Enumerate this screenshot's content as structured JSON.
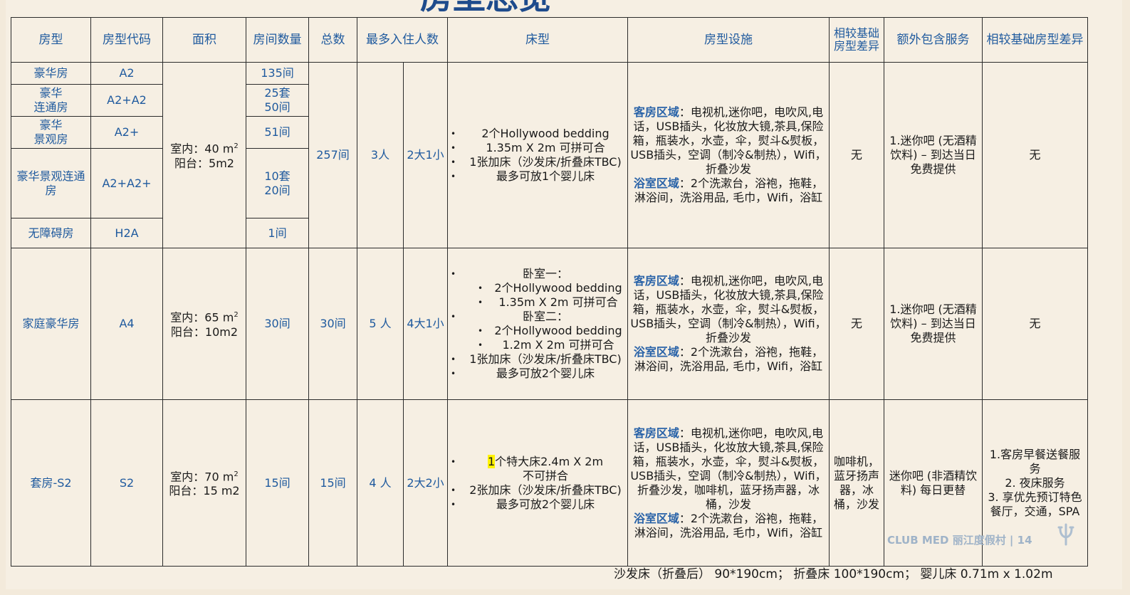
{
  "title_fragment": "房型总览",
  "headers": [
    "房型",
    "房型代码",
    "面积",
    "房间数量",
    "总数",
    "最多入住人数",
    "床型",
    "房型设施",
    "相较基础房型差异",
    "额外包含服务",
    "相较基础房型差异"
  ],
  "group1": {
    "rooms": [
      {
        "type": "豪华房",
        "code": "A2",
        "count": "135间"
      },
      {
        "type": "豪华\n连通房",
        "code": "A2+A2",
        "count": "25套\n50间"
      },
      {
        "type": "豪华\n景观房",
        "code": "A2+",
        "count": "51间"
      },
      {
        "type": "豪华景观连通房",
        "code": "A2+A2+",
        "count": "10套\n20间"
      },
      {
        "type": "无障碍房",
        "code": "H2A",
        "count": "1间"
      }
    ],
    "area_line1": "室内：40 m",
    "area_sup": "2",
    "area_line2": "阳台：5m2",
    "total": "257间",
    "max_people": "3人",
    "composition": "2大1小",
    "beds": [
      "2个Hollywood bedding",
      "1.35m X 2m 可拼可合",
      "1张加床（沙发床/折叠床TBC)",
      "最多可放1个婴儿床"
    ],
    "fac_room_label": "客房区域",
    "fac_room": "：电视机,迷你吧，电吹风,电话，USB插头，化妆放大镜,茶具,保险箱，瓶装水，水壶，伞，熨斗&熨板，USB插头，空调（制冷&制热），Wifi，折叠沙发",
    "fac_bath_label": "浴室区域",
    "fac_bath": "：2个洗漱台，浴袍，拖鞋，淋浴间，洗浴用品, 毛巾，Wifi，浴缸",
    "diff": "无",
    "service": "1.迷你吧 (无酒精饮料) – 到达当日免费提供",
    "diff2": "无"
  },
  "group2": {
    "type": "家庭豪华房",
    "code": "A4",
    "area_line1": "室内：65 m",
    "area_sup": "2",
    "area_line2": "阳台：10m2",
    "count": "30间",
    "total": "30间",
    "max_people": "5 人",
    "composition": "4大1小",
    "bedroom1": "卧室一：",
    "bedroom1_items": [
      "2个Hollywood bedding",
      "1.35m X 2m 可拼可合"
    ],
    "bedroom2": "卧室二：",
    "bedroom2_items": [
      "2个Hollywood bedding",
      "1.2m X 2m   可拼可合"
    ],
    "beds_extra": [
      "1张加床（沙发床/折叠床TBC)",
      "最多可放2个婴儿床"
    ],
    "fac_room_label": "客房区域",
    "fac_room": "：电视机,迷你吧，电吹风,电话，USB插头，化妆放大镜,茶具,保险箱，瓶装水，水壶，伞，熨斗&熨板，USB插头，空调（制冷&制热），Wifi，折叠沙发",
    "fac_bath_label": "浴室区域",
    "fac_bath": "：2个洗漱台，浴袍，拖鞋，淋浴间，洗浴用品, 毛巾，Wifi，浴缸",
    "diff": "无",
    "service": "1.迷你吧 (无酒精饮料) – 到达当日免费提供",
    "diff2": "无"
  },
  "group3": {
    "type": "套房-S2",
    "code": "S2",
    "area_line1": "室内：70 m",
    "area_sup": "2",
    "area_line2": "阳台：15 m2",
    "count": "15间",
    "total": "15间",
    "max_people": "4 人",
    "composition": "2大2小",
    "bed1_hl": "1",
    "bed1_rest": "个特大床2.4m X 2m",
    "bed1_cont": " 不可拼合",
    "beds_extra": [
      "2张加床（沙发床/折叠床TBC)",
      "最多可放2个婴儿床"
    ],
    "fac_room_label": "客房区域",
    "fac_room": "：电视机,迷你吧，电吹风,电话，USB插头，化妆放大镜,茶具,保险箱，瓶装水，水壶，伞，熨斗&熨板，USB插头，空调（制冷&制热），Wifi，折叠沙发，咖啡机，蓝牙扬声器，冰桶，沙发",
    "fac_bath_label": "浴室区域",
    "fac_bath": "：2个洗漱台，浴袍，拖鞋，淋浴间，洗浴用品, 毛巾，Wifi，浴缸",
    "diff": "咖啡机，蓝牙扬声器，冰桶，沙发",
    "service": "迷你吧 (非酒精饮料) 每日更替",
    "diff2_items": [
      "1.客房早餐送餐服务",
      "2. 夜床服务",
      "3. 享优先预订特色餐厅，交通，SPA"
    ]
  },
  "footnote": "沙发床（折叠后） 90*190cm； 折叠床 100*190cm；  婴儿床 0.71m x 1.02m",
  "page_footer": "CLUB MED 丽江度假村 | 14",
  "colors": {
    "header_blue": "#1f5a9e",
    "label_blue": "#2a63a8",
    "background": "#f6efe3"
  }
}
